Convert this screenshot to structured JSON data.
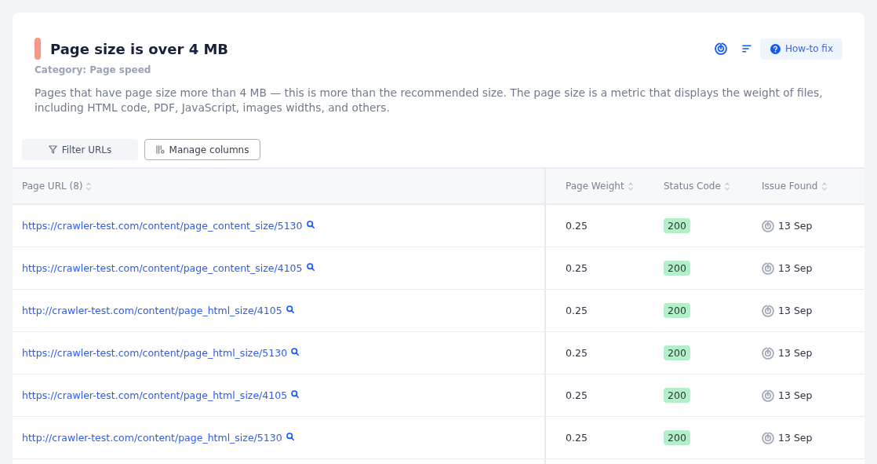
{
  "issue": {
    "title": "Page size is over 4 MB",
    "category": "Category: Page speed",
    "description": "Pages that have page size more than 4 MB — this is more than the recommended size. The page size is a metric that displays the weight of files, including HTML code, PDF, JavaScript, images widths, and others."
  },
  "header_actions": {
    "how_to_fix": "How-to fix"
  },
  "toolbar": [
    {
      "kind": "filter",
      "label": "Filter URLs"
    },
    {
      "kind": "columns",
      "label": "Manage columns"
    }
  ],
  "table": {
    "columns": [
      {
        "label": "Page URL (8)"
      },
      {
        "label": "Page Weight"
      },
      {
        "label": "Status Code"
      },
      {
        "label": "Issue Found"
      }
    ],
    "rows": [
      {
        "url": "https://crawler-test.com/content/page_content_size/5130",
        "page_weight": "0.25",
        "status_code": "200",
        "issue_found": "13 Sep"
      },
      {
        "url": "https://crawler-test.com/content/page_content_size/4105",
        "page_weight": "0.25",
        "status_code": "200",
        "issue_found": "13 Sep"
      },
      {
        "url": "http://crawler-test.com/content/page_html_size/4105",
        "page_weight": "0.25",
        "status_code": "200",
        "issue_found": "13 Sep"
      },
      {
        "url": "https://crawler-test.com/content/page_html_size/5130",
        "page_weight": "0.25",
        "status_code": "200",
        "issue_found": "13 Sep"
      },
      {
        "url": "https://crawler-test.com/content/page_html_size/4105",
        "page_weight": "0.25",
        "status_code": "200",
        "issue_found": "13 Sep"
      },
      {
        "url": "http://crawler-test.com/content/page_html_size/5130",
        "page_weight": "0.25",
        "status_code": "200",
        "issue_found": "13 Sep"
      }
    ]
  }
}
